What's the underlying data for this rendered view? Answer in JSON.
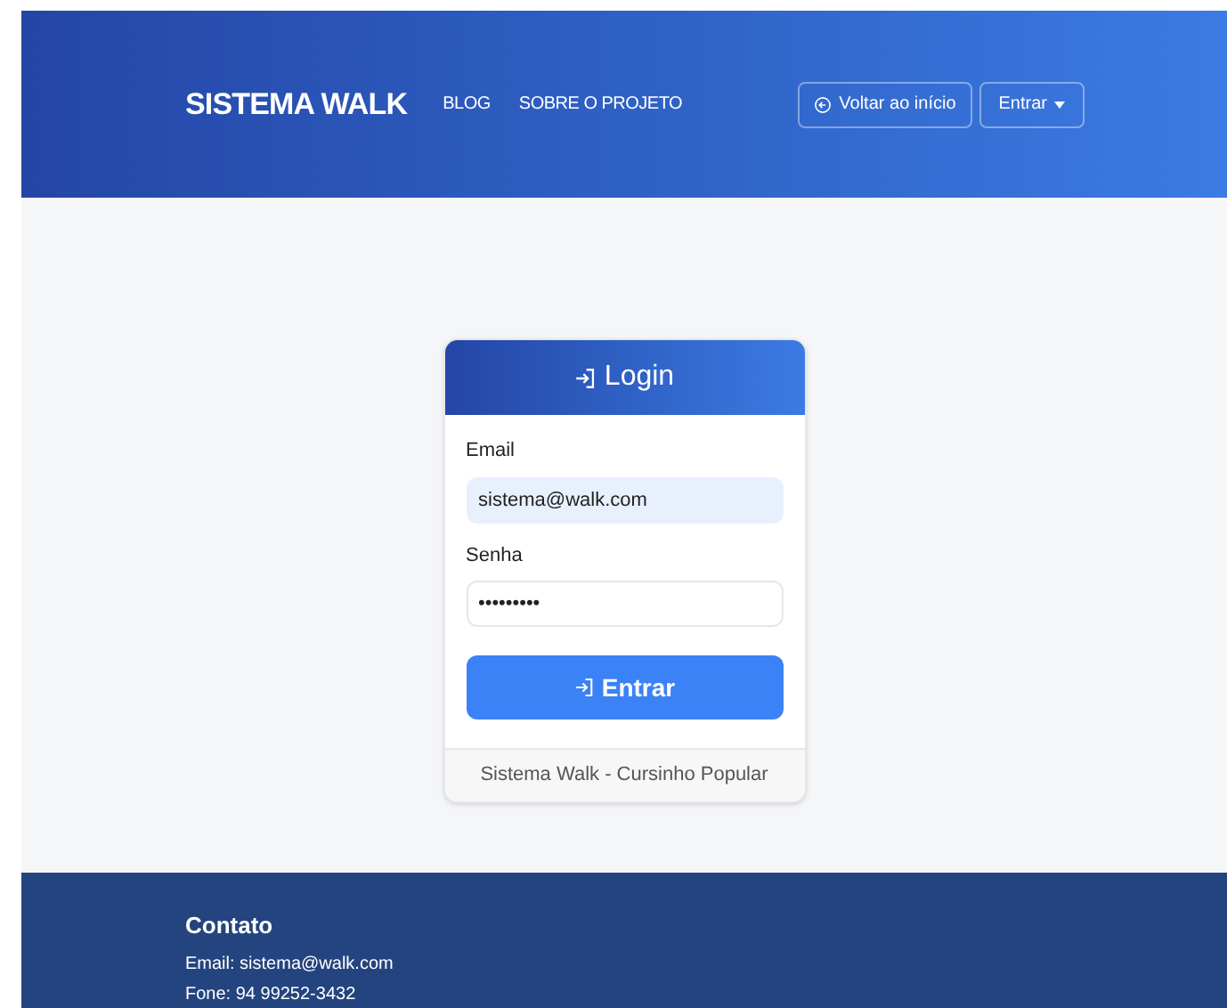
{
  "navbar": {
    "brand": "SISTEMA WALK",
    "links": [
      "BLOG",
      "SOBRE O PROJETO"
    ],
    "buttons": [
      {
        "kind": "back",
        "label": "Voltar ao início"
      },
      {
        "kind": "dropdown",
        "label": "Entrar"
      }
    ]
  },
  "login_card": {
    "title": "Login",
    "fields": [
      {
        "label": "Email",
        "value": "sistema@walk.com",
        "autofilled": true
      },
      {
        "label": "Senha",
        "value": "•••••••••",
        "autofilled": false
      }
    ],
    "submit": "Entrar",
    "footer": "Sistema Walk - Cursinho Popular"
  },
  "footer": {
    "heading": "Contato",
    "lines": [
      "Email: sistema@walk.com",
      "Fone: 94 99252-3432"
    ]
  }
}
